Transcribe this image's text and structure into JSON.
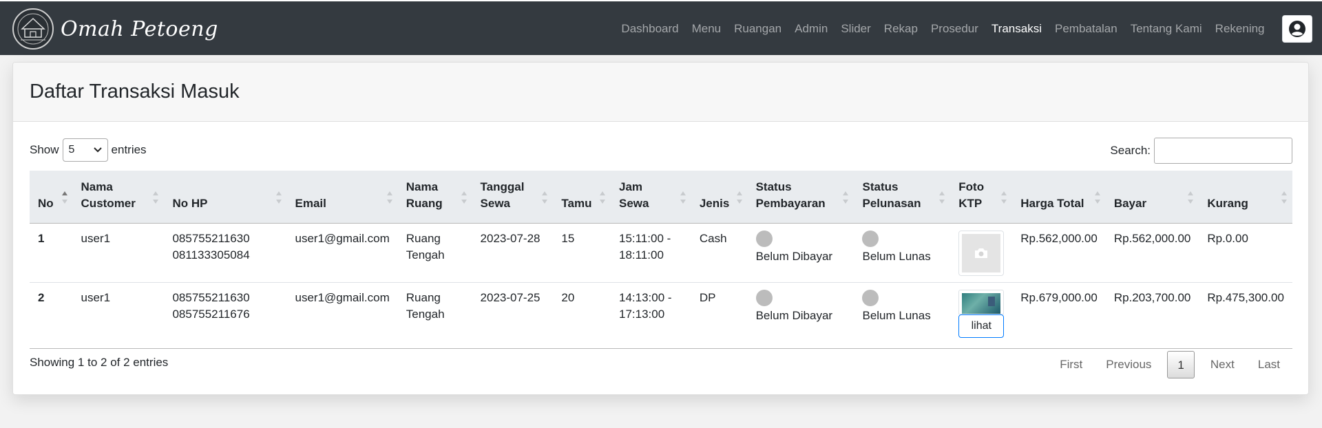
{
  "brand": {
    "name": "Omah Petoeng",
    "logo_icon": "traditional-house-emblem"
  },
  "nav": {
    "items": [
      {
        "label": "Dashboard",
        "active": false
      },
      {
        "label": "Menu",
        "active": false
      },
      {
        "label": "Ruangan",
        "active": false
      },
      {
        "label": "Admin",
        "active": false
      },
      {
        "label": "Slider",
        "active": false
      },
      {
        "label": "Rekap",
        "active": false
      },
      {
        "label": "Prosedur",
        "active": false
      },
      {
        "label": "Transaksi",
        "active": true
      },
      {
        "label": "Pembatalan",
        "active": false
      },
      {
        "label": "Tentang Kami",
        "active": false
      },
      {
        "label": "Rekening",
        "active": false
      }
    ],
    "user_icon": "user-circle-icon"
  },
  "page": {
    "title": "Daftar Transaksi Masuk"
  },
  "controls": {
    "show_label": "Show",
    "entries_value": "5",
    "entries_label": "entries",
    "search_label": "Search:",
    "search_value": ""
  },
  "table": {
    "headers": [
      [
        "No"
      ],
      [
        "Nama",
        "Customer"
      ],
      [
        "No HP"
      ],
      [
        "Email"
      ],
      [
        "Nama",
        "Ruang"
      ],
      [
        "Tanggal",
        "Sewa"
      ],
      [
        "Tamu"
      ],
      [
        "Jam",
        "Sewa"
      ],
      [
        "Jenis"
      ],
      [
        "Status",
        "Pembayaran"
      ],
      [
        "Status",
        "Pelunasan"
      ],
      [
        "Foto",
        "KTP"
      ],
      [
        "Harga Total"
      ],
      [
        "Bayar"
      ],
      [
        "Kurang"
      ]
    ],
    "rows": [
      {
        "no": "1",
        "customer": "user1",
        "hp1": "085755211630",
        "hp2": "081133305084",
        "email": "user1@gmail.com",
        "ruang1": "Ruang",
        "ruang2": "Tengah",
        "tanggal": "2023-07-28",
        "tamu": "15",
        "jam1": "15:11:00 -",
        "jam2": "18:11:00",
        "jenis": "Cash",
        "status_bayar": "Belum Dibayar",
        "status_lunas": "Belum Lunas",
        "ktp": "placeholder",
        "harga": "Rp.562,000.00",
        "bayar": "Rp.562,000.00",
        "kurang": "Rp.0.00"
      },
      {
        "no": "2",
        "customer": "user1",
        "hp1": "085755211630",
        "hp2": "085755211676",
        "email": "user1@gmail.com",
        "ruang1": "Ruang",
        "ruang2": "Tengah",
        "tanggal": "2023-07-25",
        "tamu": "20",
        "jam1": "14:13:00 -",
        "jam2": "17:13:00",
        "jenis": "DP",
        "status_bayar": "Belum Dibayar",
        "status_lunas": "Belum Lunas",
        "ktp": "photo",
        "ktp_button": "lihat",
        "harga": "Rp.679,000.00",
        "bayar": "Rp.203,700.00",
        "kurang": "Rp.475,300.00"
      }
    ]
  },
  "footer": {
    "info": "Showing 1 to 2 of 2 entries",
    "first": "First",
    "previous": "Previous",
    "current": "1",
    "next": "Next",
    "last": "Last"
  },
  "colors": {
    "navbar": "#343a40",
    "link_button_border": "#007bff",
    "status_dot": "#bcbcbc"
  }
}
